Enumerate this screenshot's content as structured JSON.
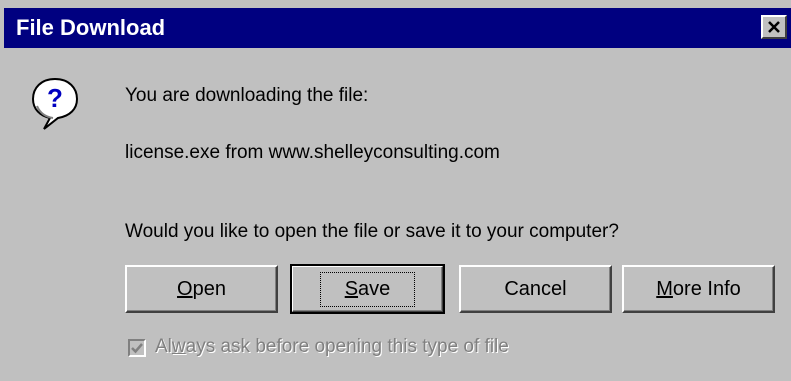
{
  "window": {
    "title": "File Download",
    "close_icon": "close-icon"
  },
  "dialog": {
    "icon": "question-balloon-icon",
    "message_line1": "You are downloading the file:",
    "message_line2": "license.exe from www.shelleyconsulting.com",
    "question": "Would you like to open the file or save it to your computer?"
  },
  "buttons": {
    "open": {
      "mnemonic": "O",
      "rest": "pen"
    },
    "save": {
      "mnemonic": "S",
      "rest": "ave"
    },
    "cancel": {
      "label": "Cancel"
    },
    "more_info": {
      "mnemonic": "M",
      "rest": "ore Info"
    }
  },
  "checkbox": {
    "checked": true,
    "enabled": false,
    "label_pre": "Al",
    "label_mnemonic": "w",
    "label_post": "ays ask before opening this type of file"
  },
  "colors": {
    "titlebar": "#000080",
    "face": "#c0c0c0",
    "disabled_text": "#808080"
  }
}
